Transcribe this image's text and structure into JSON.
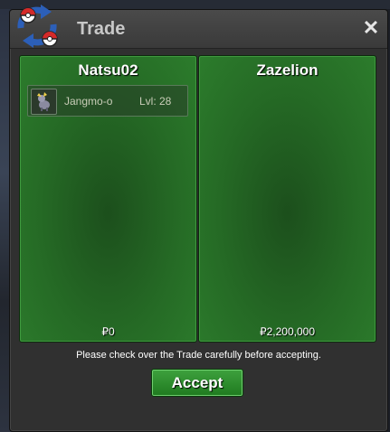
{
  "window": {
    "title": "Trade",
    "close_label": "✕"
  },
  "left_trader": {
    "name": "Natsu02",
    "money": "₽0",
    "items": [
      {
        "name": "Jangmo-o",
        "level": "Lvl: 28",
        "icon": "jangmo-o-sprite-icon"
      }
    ]
  },
  "right_trader": {
    "name": "Zazelion",
    "money": "₽2,200,000",
    "items": []
  },
  "footer": {
    "notice": "Please check over the Trade carefully before accepting.",
    "accept_label": "Accept"
  },
  "colors": {
    "panel_green": "#256a25",
    "button_green": "#2e8f2e",
    "window_bg": "#303030",
    "title_text": "#c8c8c8"
  }
}
